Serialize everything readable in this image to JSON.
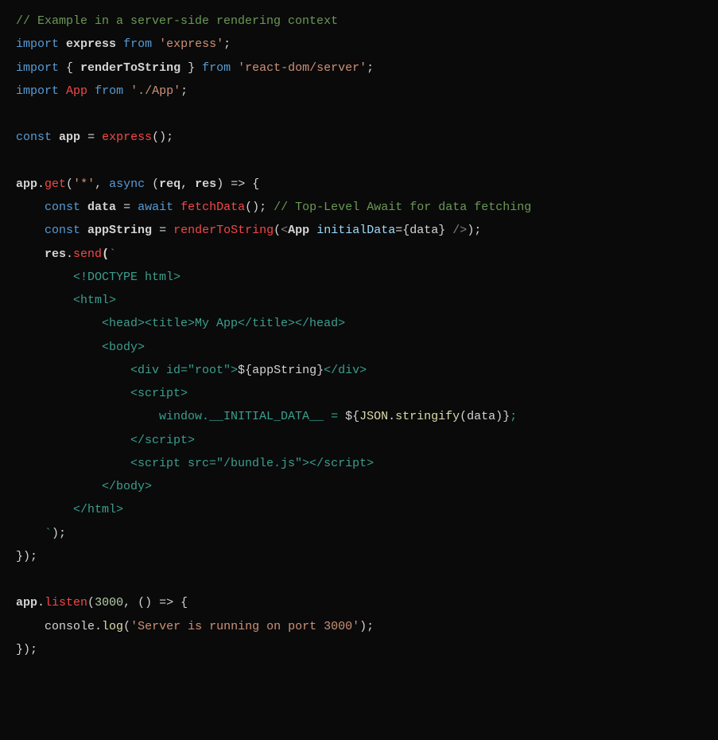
{
  "code": {
    "l1_comment": "// Example in a server-side rendering context",
    "l2_import": "import",
    "l2_name": "express",
    "l2_from": "from",
    "l2_mod": "'express'",
    "l3_import": "import",
    "l3_name": "renderToString",
    "l3_from": "from",
    "l3_mod": "'react-dom/server'",
    "l4_import": "import",
    "l4_name": "App",
    "l4_from": "from",
    "l4_mod": "'./App'",
    "l6_const": "const",
    "l6_name": "app",
    "l6_eq": "=",
    "l6_call": "express",
    "l8_obj": "app",
    "l8_get": "get",
    "l8_path": "'*'",
    "l8_async": "async",
    "l8_req": "req",
    "l8_res": "res",
    "l9_const": "const",
    "l9_name": "data",
    "l9_eq": "=",
    "l9_await": "await",
    "l9_call": "fetchData",
    "l9_comment": "// Top-Level Await for data fetching",
    "l10_const": "const",
    "l10_name": "appString",
    "l10_eq": "=",
    "l10_call": "renderToString",
    "l10_comp": "App",
    "l10_attr": "initialData",
    "l10_val": "data",
    "l11_res": "res",
    "l11_send": "send",
    "l12": "        <!DOCTYPE html>",
    "l13": "        <html>",
    "l14": "            <head><title>My App</title></head>",
    "l15": "            <body>",
    "l16a": "                <div id=\"root\">",
    "l16b": "appString",
    "l16c": "</div>",
    "l17": "                <script>",
    "l18a": "                    window.__INITIAL_DATA__ = ",
    "l18b": "JSON",
    "l18c": "stringify",
    "l18d": "data",
    "l19": "                </script>",
    "l20": "                <script src=\"/bundle.js\"></script>",
    "l21": "            </body>",
    "l22": "        </html>",
    "l23": "    `",
    "l26_obj": "app",
    "l26_listen": "listen",
    "l26_port": "3000",
    "l27_console": "console",
    "l27_log": "log",
    "l27_msg": "'Server is running on port 3000'"
  }
}
